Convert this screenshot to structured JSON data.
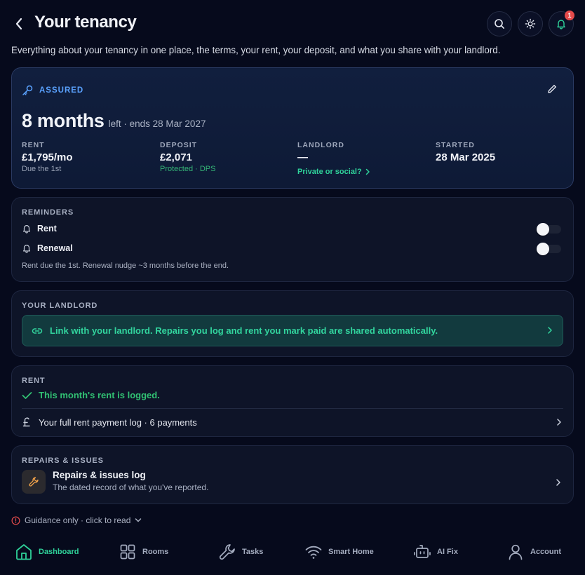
{
  "header": {
    "title": "Your tenancy",
    "notifications_count": "1"
  },
  "subtitle": "Everything about your tenancy in one place, the terms, your rent, your deposit, and what you share with your landlord.",
  "tenancy": {
    "type": "ASSURED",
    "months_left": "8 months",
    "ends_text": "left · ends 28 Mar 2027",
    "stats": [
      {
        "label": "RENT",
        "value": "£1,795/mo",
        "sub": "Due the 1st"
      },
      {
        "label": "DEPOSIT",
        "value": "£2,071",
        "sub": "Protected · DPS"
      },
      {
        "label": "LANDLORD",
        "value": "—",
        "link": "Private or social?"
      },
      {
        "label": "STARTED",
        "value": "28 Mar 2025"
      }
    ]
  },
  "reminders": {
    "label": "REMINDERS",
    "items": [
      {
        "label": "Rent",
        "enabled": false
      },
      {
        "label": "Renewal",
        "enabled": false
      }
    ],
    "note": "Rent due the 1st. Renewal nudge ~3 months before the end."
  },
  "landlord": {
    "label": "YOUR LANDLORD",
    "link_text": "Link with your landlord. Repairs you log and rent you mark paid are shared automatically."
  },
  "rent": {
    "label": "RENT",
    "status": "This month's rent is logged.",
    "log_text": "Your full rent payment log · 6 payments"
  },
  "repairs": {
    "label": "REPAIRS & ISSUES",
    "title": "Repairs & issues log",
    "subtitle": "The dated record of what you've reported."
  },
  "guidance": "Guidance only · click to read",
  "nav": [
    {
      "label": "Dashboard",
      "icon": "home-icon",
      "active": true
    },
    {
      "label": "Rooms",
      "icon": "grid-icon",
      "active": false
    },
    {
      "label": "Tasks",
      "icon": "wrench-icon",
      "active": false
    },
    {
      "label": "Smart Home",
      "icon": "wifi-icon",
      "active": false
    },
    {
      "label": "AI Fix",
      "icon": "robot-icon",
      "active": false
    },
    {
      "label": "Account",
      "icon": "user-icon",
      "active": false
    }
  ],
  "colors": {
    "background": "#060a1c",
    "accent_green": "#2fd29a",
    "accent_blue": "#5aa2ff",
    "badge_red": "#e44a4a",
    "success_green": "#31c173"
  }
}
